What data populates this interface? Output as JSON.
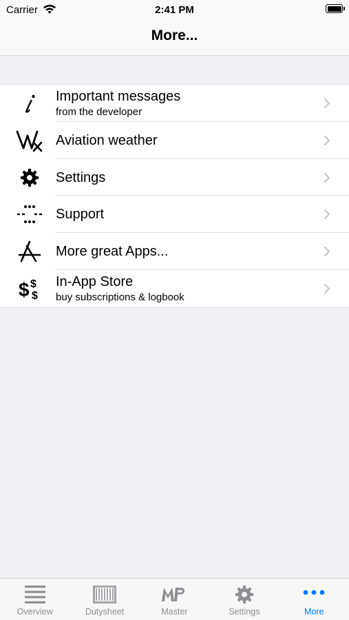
{
  "status_bar": {
    "carrier": "Carrier",
    "time": "2:41 PM"
  },
  "nav": {
    "title": "More..."
  },
  "menu": {
    "items": [
      {
        "title": "Important messages",
        "subtitle": "from the developer",
        "icon": "info-italic-icon"
      },
      {
        "title": "Aviation weather",
        "subtitle": "",
        "icon": "wx-icon"
      },
      {
        "title": "Settings",
        "subtitle": "",
        "icon": "gear-icon"
      },
      {
        "title": "Support",
        "subtitle": "",
        "icon": "support-dots-icon"
      },
      {
        "title": "More great Apps...",
        "subtitle": "",
        "icon": "app-store-icon"
      },
      {
        "title": "In-App Store",
        "subtitle": "buy subscriptions & logbook",
        "icon": "dollar-signs-icon"
      }
    ]
  },
  "tabbar": {
    "tabs": [
      {
        "label": "Overview",
        "icon": "list-lines-icon",
        "active": false
      },
      {
        "label": "Dutysheet",
        "icon": "dutysheet-icon",
        "active": false
      },
      {
        "label": "Master",
        "icon": "mp-logo-icon",
        "active": false
      },
      {
        "label": "Settings",
        "icon": "gear-icon",
        "active": false
      },
      {
        "label": "More",
        "icon": "ellipsis-icon",
        "active": true
      }
    ]
  },
  "colors": {
    "accent": "#007aff",
    "inactive": "#8e8e93",
    "background": "#efeff4"
  }
}
